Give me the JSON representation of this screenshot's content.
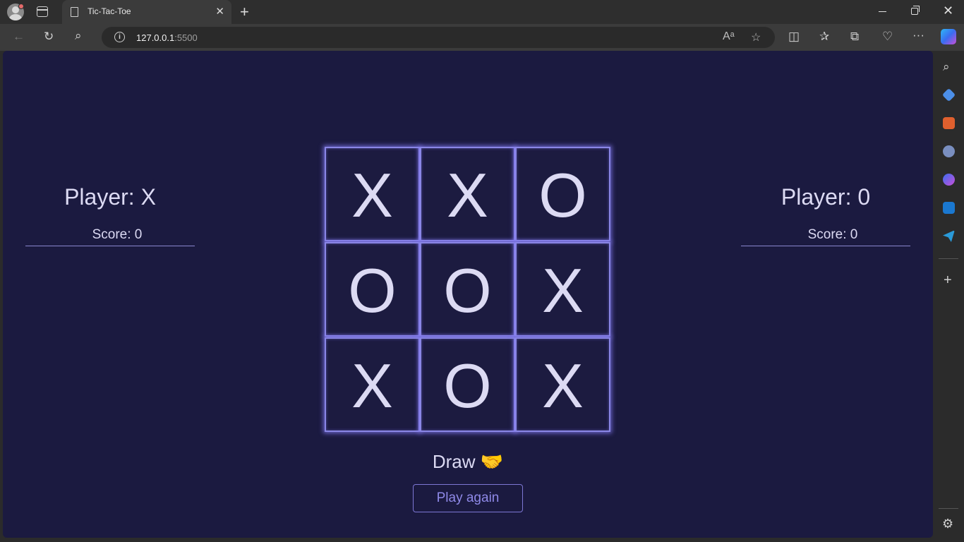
{
  "browser": {
    "tab_title": "Tic-Tac-Toe",
    "url_host": "127.0.0.1",
    "url_port": ":5500"
  },
  "game": {
    "player_left": {
      "label": "Player: X",
      "score": "Score: 0"
    },
    "player_right": {
      "label": "Player: 0",
      "score": "Score: 0"
    },
    "board": [
      "X",
      "X",
      "O",
      "O",
      "O",
      "X",
      "X",
      "O",
      "X"
    ],
    "status": "Draw 🤝",
    "play_again_label": "Play again"
  },
  "colors": {
    "page_background": "#1b1a40",
    "grid_glow": "#8a86e6",
    "text": "#dcdaf3",
    "accent": "#8f89e8"
  }
}
